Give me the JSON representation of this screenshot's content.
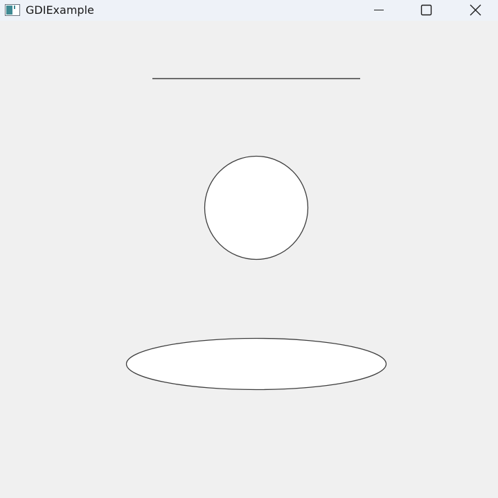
{
  "window": {
    "title": "GDIExample",
    "icon": "app-window-icon",
    "controls": {
      "minimize_icon": "minimize-icon",
      "maximize_icon": "maximize-icon",
      "close_icon": "close-icon"
    }
  },
  "colors": {
    "client_background": "#f0f0f0",
    "titlebar_background": "#eef2f8",
    "stroke": "#3c3c3c",
    "shape_fill": "#ffffff"
  }
}
